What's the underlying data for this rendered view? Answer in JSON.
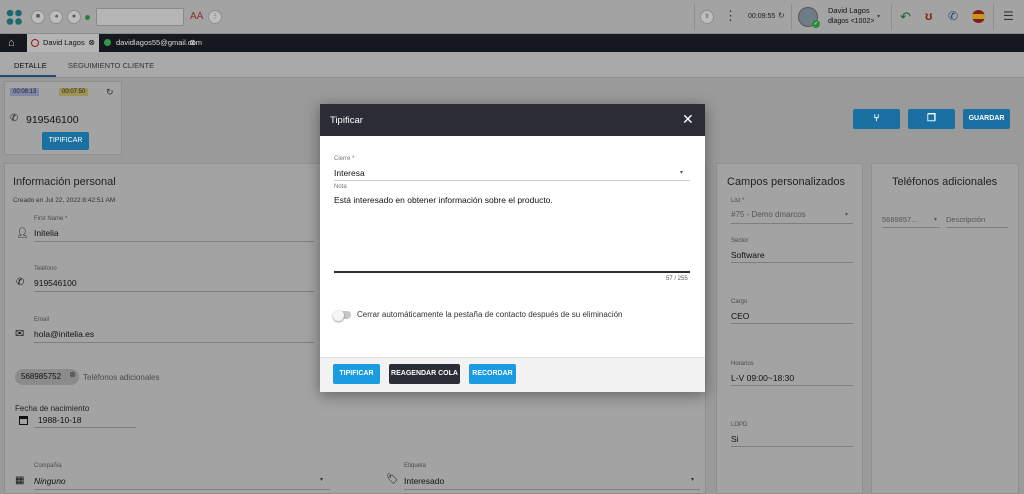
{
  "header": {
    "font_size_label": "AA",
    "timer": "00:09:55",
    "user_name": "David Lagos",
    "user_ext": "dlagos <1002>"
  },
  "contact_tabs": [
    {
      "label": "David Lagos"
    },
    {
      "label": "davidlagos55@gmail.com"
    }
  ],
  "subtabs": [
    "DETALLE",
    "SEGUIMIENTO CLIENTE"
  ],
  "call_card": {
    "timer1": "00:08:13",
    "timer2": "00:07:50",
    "phone": "919546100",
    "tipificar": "TIPIFICAR"
  },
  "actions": {
    "guardar": "GUARDAR"
  },
  "personal": {
    "title": "Información personal",
    "created": "Creado en Jul 22, 2022 8:42:51 AM",
    "first_name_label": "First Name *",
    "first_name": "Initelia",
    "phone_label": "Teléfono",
    "phone": "919546100",
    "email_label": "Email",
    "email": "hola@initelia.es",
    "chip": "568985752",
    "chip_placeholder": "Teléfonos adicionales",
    "birth_label": "Fecha de nacimiento",
    "birth": "1988-10-18",
    "company_label": "Compañía",
    "company": "Ninguno",
    "tag_label": "Etiqueta",
    "tag": "Interesado"
  },
  "custom": {
    "title": "Campos personalizados",
    "list_label": "List *",
    "list_value": "#75 - Demo dmarcos",
    "sector_label": "Sector",
    "sector": "Software",
    "cargo_label": "Cargo",
    "cargo": "CEO",
    "horarios_label": "Horarios",
    "horarios": "L-V 09:00~18:30",
    "lopd_label": "LOPD",
    "lopd": "Si"
  },
  "extra_phones": {
    "title": "Teléfonos adicionales",
    "phone": "5689857...",
    "desc": "Descripción"
  },
  "modal": {
    "title": "Tipificar",
    "cierre_label": "Cierre *",
    "cierre_value": "Interesa",
    "nota_label": "Nota",
    "nota_value": "Está interesado en obtener información sobre el producto.",
    "counter": "57 / 255",
    "toggle_label": "Cerrar automáticamente la pestaña de contacto después de su eliminación",
    "btn_tipificar": "TIPIFICAR",
    "btn_reagendar": "REAGENDAR COLA",
    "btn_recordar": "RECORDAR"
  },
  "colors": {
    "primary": "#1a9be2",
    "dark": "#2a2d35",
    "overlay": "#9a9a9a"
  }
}
